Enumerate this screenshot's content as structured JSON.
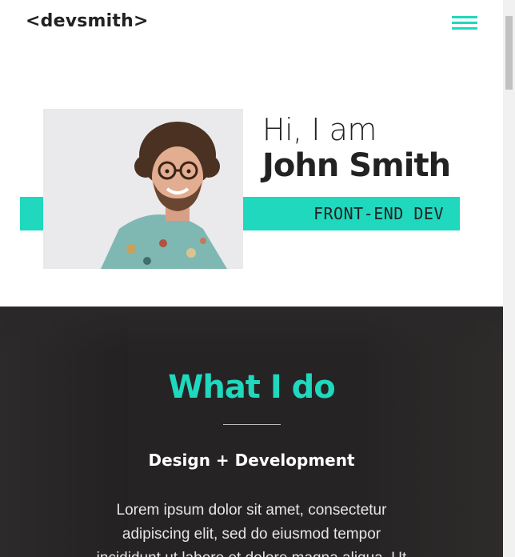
{
  "header": {
    "logo": "<devsmith>",
    "menu_icon": "hamburger-menu-icon",
    "accent_color": "#1fd8bd"
  },
  "hero": {
    "greeting": "Hi, I am",
    "name": "John Smith",
    "role": "FRONT-END DEV",
    "photo": "portrait-photo"
  },
  "what_i_do": {
    "title": "What I do",
    "subtitle": "Design + Development",
    "body": "Lorem ipsum dolor sit amet, consectetur adipiscing elit, sed do eiusmod tempor incididunt ut labore et dolore magna aliqua. Ut"
  }
}
